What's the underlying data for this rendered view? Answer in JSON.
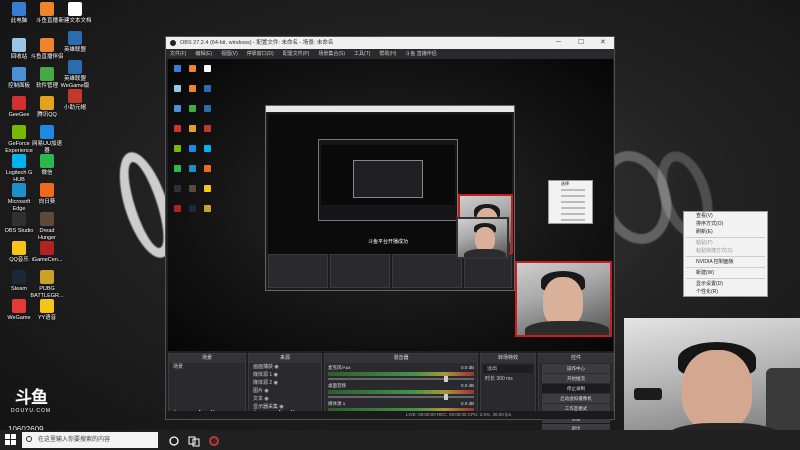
{
  "desktop": {
    "icons": [
      {
        "label": "此电脑",
        "color": "#3a7bd5"
      },
      {
        "label": "斗鱼直播",
        "color": "#f0842d"
      },
      {
        "label": "新建文本文档",
        "color": "#ffffff"
      },
      {
        "label": "回收站",
        "color": "#9cc4e4"
      },
      {
        "label": "斗鱼直播伴侣",
        "color": "#f0842d"
      },
      {
        "label": "英雄联盟",
        "color": "#2b6cb0"
      },
      {
        "label": "控制面板",
        "color": "#4a90d9"
      },
      {
        "label": "软件管理",
        "color": "#44aa44"
      },
      {
        "label": "英雄联盟WeGame版",
        "color": "#2b6cb0"
      },
      {
        "label": "GeeGee",
        "color": "#d03030"
      },
      {
        "label": "腾讯QQ",
        "color": "#e5a21d"
      },
      {
        "label": "小助元帽",
        "color": "#c0392b"
      },
      {
        "label": "GeForce Experience",
        "color": "#76b900"
      },
      {
        "label": "网易UU加速器",
        "color": "#1e88e5"
      },
      {
        "label": "Logitech G HUB",
        "color": "#00b4f0"
      },
      {
        "label": "微信",
        "color": "#2db84d"
      },
      {
        "label": "Microsoft Edge",
        "color": "#1e90c8"
      },
      {
        "label": "向日葵",
        "color": "#f06a1d"
      },
      {
        "label": "OBS Studio",
        "color": "#303030"
      },
      {
        "label": "Dread Hunger",
        "color": "#5c4a3a"
      },
      {
        "label": "QQ音乐",
        "color": "#f5c518"
      },
      {
        "label": "iGameCen...",
        "color": "#b22222"
      },
      {
        "label": "Steam",
        "color": "#1b2838"
      },
      {
        "label": "PUBG BATTLEGR...",
        "color": "#c9a227"
      },
      {
        "label": "WeGame",
        "color": "#e53935"
      },
      {
        "label": "YY语音",
        "color": "#f5c518"
      }
    ],
    "douyu_logo": "斗鱼",
    "douyu_sub": "DOUYU.COM",
    "room_id": "10602609"
  },
  "obs": {
    "title": "OBS 27.2.4 (64-bit, windows) - 配置文件: 未命名 - 场景: 未命名",
    "menu": [
      "文件(F)",
      "编辑(E)",
      "视图(V)",
      "停靠窗口(D)",
      "配置文件(P)",
      "场景集合(S)",
      "工具(T)",
      "帮助(H)",
      "斗鱼 直播伴侣"
    ],
    "docks": {
      "scenes": {
        "title": "场景",
        "items": [
          "场景"
        ]
      },
      "sources": {
        "title": "来源",
        "items": [
          "画面捕获",
          "媒体源 1",
          "媒体源 2",
          "图片",
          "文本",
          "显示器采集"
        ]
      },
      "mixer": {
        "title": "混音器",
        "channels": [
          {
            "name": "麦克风/Aux",
            "db": "0.0 dB"
          },
          {
            "name": "桌面音频",
            "db": "0.0 dB"
          },
          {
            "name": "媒体源 1",
            "db": "0.0 dB"
          }
        ]
      },
      "transitions": {
        "title": "转场特效",
        "type": "淡出",
        "duration_label": "时长",
        "duration": "300 ms"
      },
      "controls": {
        "title": "控件",
        "buttons": [
          "开始推流",
          "停止录制",
          "启动虚拟摄像机",
          "工作室模式",
          "设置",
          "退出"
        ],
        "top": "操作中心"
      }
    },
    "status": "LIVE: 00:00:00   REC: 00:00:00   CPU: 2.0%, 30.00 fps",
    "caption": "斗鱼平台开播成功",
    "dock_footer": "+ − ∧ ∨"
  },
  "context_menu": {
    "items": [
      {
        "label": "查看(V)",
        "disabled": false
      },
      {
        "label": "排序方式(O)",
        "disabled": false
      },
      {
        "label": "刷新(E)",
        "disabled": false
      },
      {
        "label": "粘贴(P)",
        "disabled": true
      },
      {
        "label": "粘贴快捷方式(S)",
        "disabled": true
      },
      {
        "label": "NVIDIA 控制面板",
        "disabled": false
      },
      {
        "label": "新建(W)",
        "disabled": false
      },
      {
        "label": "显示设置(D)",
        "disabled": false
      },
      {
        "label": "个性化(R)",
        "disabled": false
      }
    ]
  },
  "small_menu": {
    "items": [
      "选择",
      "",
      "",
      "",
      "",
      "",
      ""
    ]
  },
  "taskbar": {
    "search_placeholder": "在这里输入你要搜索的内容"
  }
}
